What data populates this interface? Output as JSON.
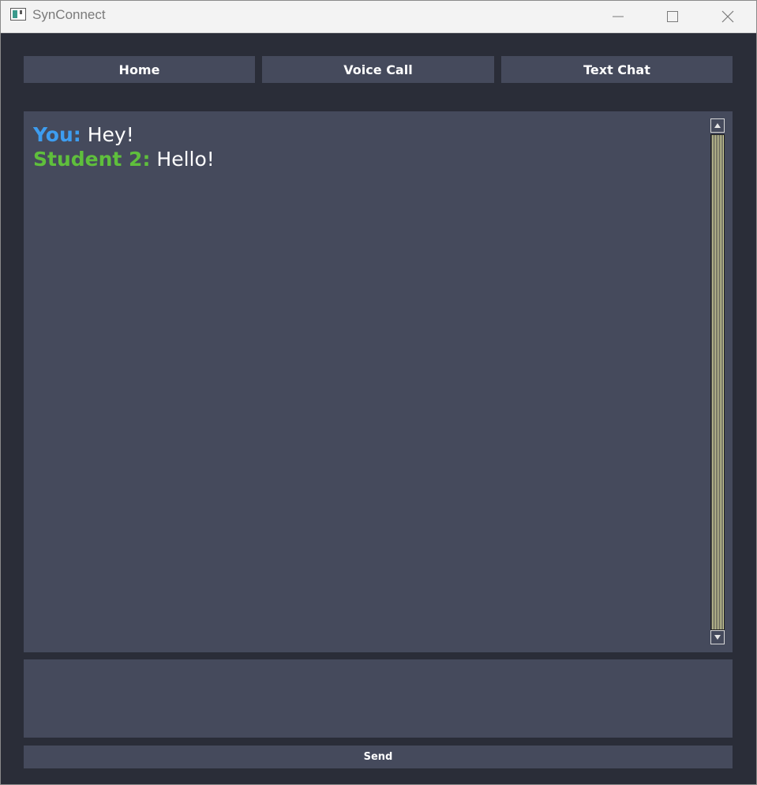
{
  "window": {
    "title": "SynConnect",
    "icon": "app-window-icon",
    "controls": {
      "minimize_icon": "minimize-icon",
      "maximize_icon": "maximize-icon",
      "close_icon": "close-icon"
    }
  },
  "nav": {
    "items": [
      {
        "label": "Home"
      },
      {
        "label": "Voice Call"
      },
      {
        "label": "Text Chat"
      }
    ]
  },
  "chat": {
    "messages": [
      {
        "sender": "You:",
        "text": "Hey!",
        "sender_color": "#3d9df0"
      },
      {
        "sender": "Student 2:",
        "text": "Hello!",
        "sender_color": "#5fbf3c"
      }
    ]
  },
  "compose": {
    "value": "",
    "placeholder": ""
  },
  "send": {
    "label": "Send"
  },
  "colors": {
    "background": "#2a2d38",
    "panel": "#454a5c",
    "text": "#ffffff",
    "you_accent": "#3d9df0",
    "student_accent": "#5fbf3c"
  }
}
